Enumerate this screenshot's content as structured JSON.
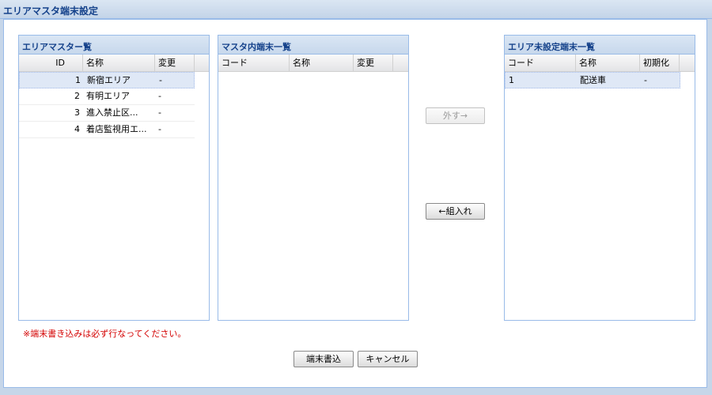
{
  "window": {
    "title": "エリアマスタ端末設定"
  },
  "area_panel": {
    "title": "エリアマスター覧",
    "columns": [
      "ID",
      "名称",
      "変更"
    ],
    "rows": [
      {
        "id": "1",
        "name": "新宿エリア",
        "change": "-",
        "selected": true
      },
      {
        "id": "2",
        "name": "有明エリア",
        "change": "-"
      },
      {
        "id": "3",
        "name": "進入禁止区...",
        "change": "-"
      },
      {
        "id": "4",
        "name": "着店監視用エ...",
        "change": "-"
      }
    ]
  },
  "master_panel": {
    "title": "マスタ内端末一覧",
    "columns": [
      "コード",
      "名称",
      "変更"
    ]
  },
  "unset_panel": {
    "title": "エリア未設定端末一覧",
    "columns": [
      "コード",
      "名称",
      "初期化"
    ],
    "rows": [
      {
        "code": "1",
        "name": "配送車",
        "init": "-",
        "selected": true
      }
    ]
  },
  "buttons": {
    "remove": "外す→",
    "add": "←組入れ",
    "write": "端末書込",
    "cancel": "キャンセル"
  },
  "note": "※端末書き込みは必ず行なってください。"
}
